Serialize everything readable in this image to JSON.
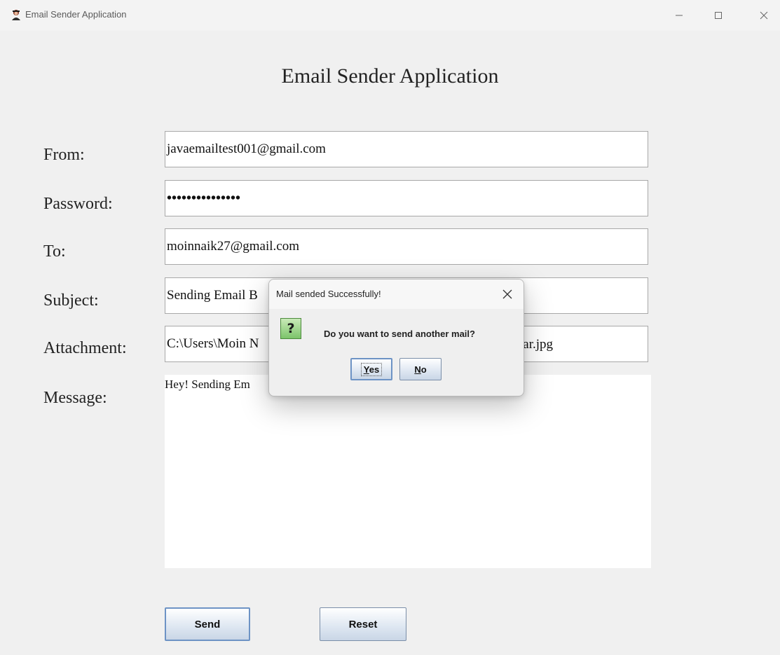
{
  "window": {
    "title": "Email Sender Application",
    "minimize_label": "minimize",
    "maximize_label": "maximize",
    "close_label": "close"
  },
  "form": {
    "heading": "Email Sender Application",
    "from_label": "From:",
    "from_value": "javaemailtest001@gmail.com",
    "password_label": "Password:",
    "password_value": "•••••••••••••••",
    "to_label": "To:",
    "to_value": "moinnaik27@gmail.com",
    "subject_label": "Subject:",
    "subject_value": "Sending Email B",
    "attachment_label": "Attachment:",
    "attachment_value_start": "C:\\Users\\Moin N",
    "attachment_value_end": "tar.jpg",
    "message_label": "Message:",
    "message_value": "Hey! Sending Em",
    "send_label": "Send",
    "reset_label": "Reset"
  },
  "dialog": {
    "title": "Mail sended Successfully!",
    "icon": "question-icon",
    "question_mark": "?",
    "message": "Do you want to send another mail?",
    "yes_mnemonic": "Y",
    "yes_rest": "es",
    "no_mnemonic": "N",
    "no_rest": "o"
  }
}
